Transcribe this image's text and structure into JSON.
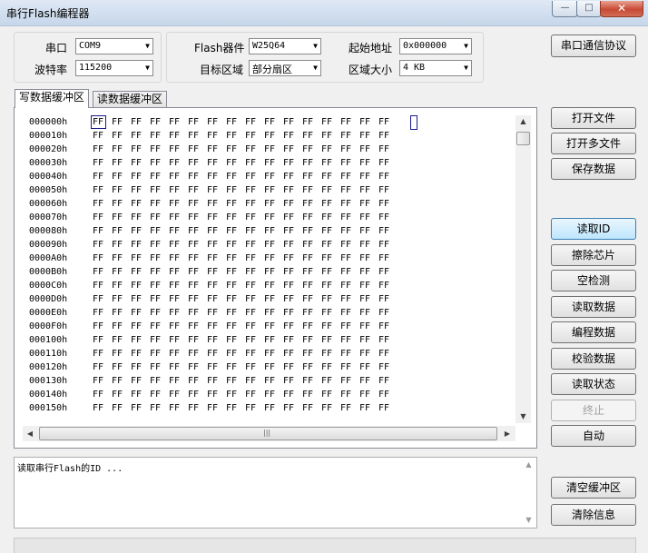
{
  "window": {
    "title": "串行Flash编程器",
    "minimize_glyph": "—",
    "maximize_glyph": "□",
    "close_glyph": "✕"
  },
  "serial": {
    "port_label": "串口",
    "port_value": "COM9",
    "baud_label": "波特率",
    "baud_value": "115200"
  },
  "flash": {
    "device_label": "Flash器件",
    "device_value": "W25Q64",
    "target_label": "目标区域",
    "target_value": "部分扇区",
    "start_label": "起始地址",
    "start_value": "0x000000",
    "size_label": "区域大小",
    "size_value": "4 KB"
  },
  "buttons": {
    "protocol": "串口通信协议",
    "open_file": "打开文件",
    "open_multi": "打开多文件",
    "save_data": "保存数据",
    "read_id": "读取ID",
    "erase_chip": "擦除芯片",
    "blank_check": "空检测",
    "read_data": "读取数据",
    "program_data": "编程数据",
    "verify_data": "校验数据",
    "read_status": "读取状态",
    "stop": "终止",
    "auto": "自动",
    "clear_buffer": "清空缓冲区",
    "clear_info": "清除信息"
  },
  "tabs": {
    "write_buffer": "写数据缓冲区",
    "read_buffer": "读数据缓冲区",
    "active": "write_buffer"
  },
  "hexdump": {
    "addresses": [
      "000000h",
      "000010h",
      "000020h",
      "000030h",
      "000040h",
      "000050h",
      "000060h",
      "000070h",
      "000080h",
      "000090h",
      "0000A0h",
      "0000B0h",
      "0000C0h",
      "0000D0h",
      "0000E0h",
      "0000F0h",
      "000100h",
      "000110h",
      "000120h",
      "000130h",
      "000140h",
      "000150h"
    ],
    "byte_value": "FF",
    "bytes_per_row": 16
  },
  "scrollbar": {
    "up_glyph": "▲",
    "down_glyph": "▼",
    "left_glyph": "◀",
    "right_glyph": "▶",
    "grip_glyph": "|||"
  },
  "log": {
    "lines": [
      "读取串行Flash的ID ..."
    ]
  },
  "icons": {
    "dropdown": "▼"
  }
}
